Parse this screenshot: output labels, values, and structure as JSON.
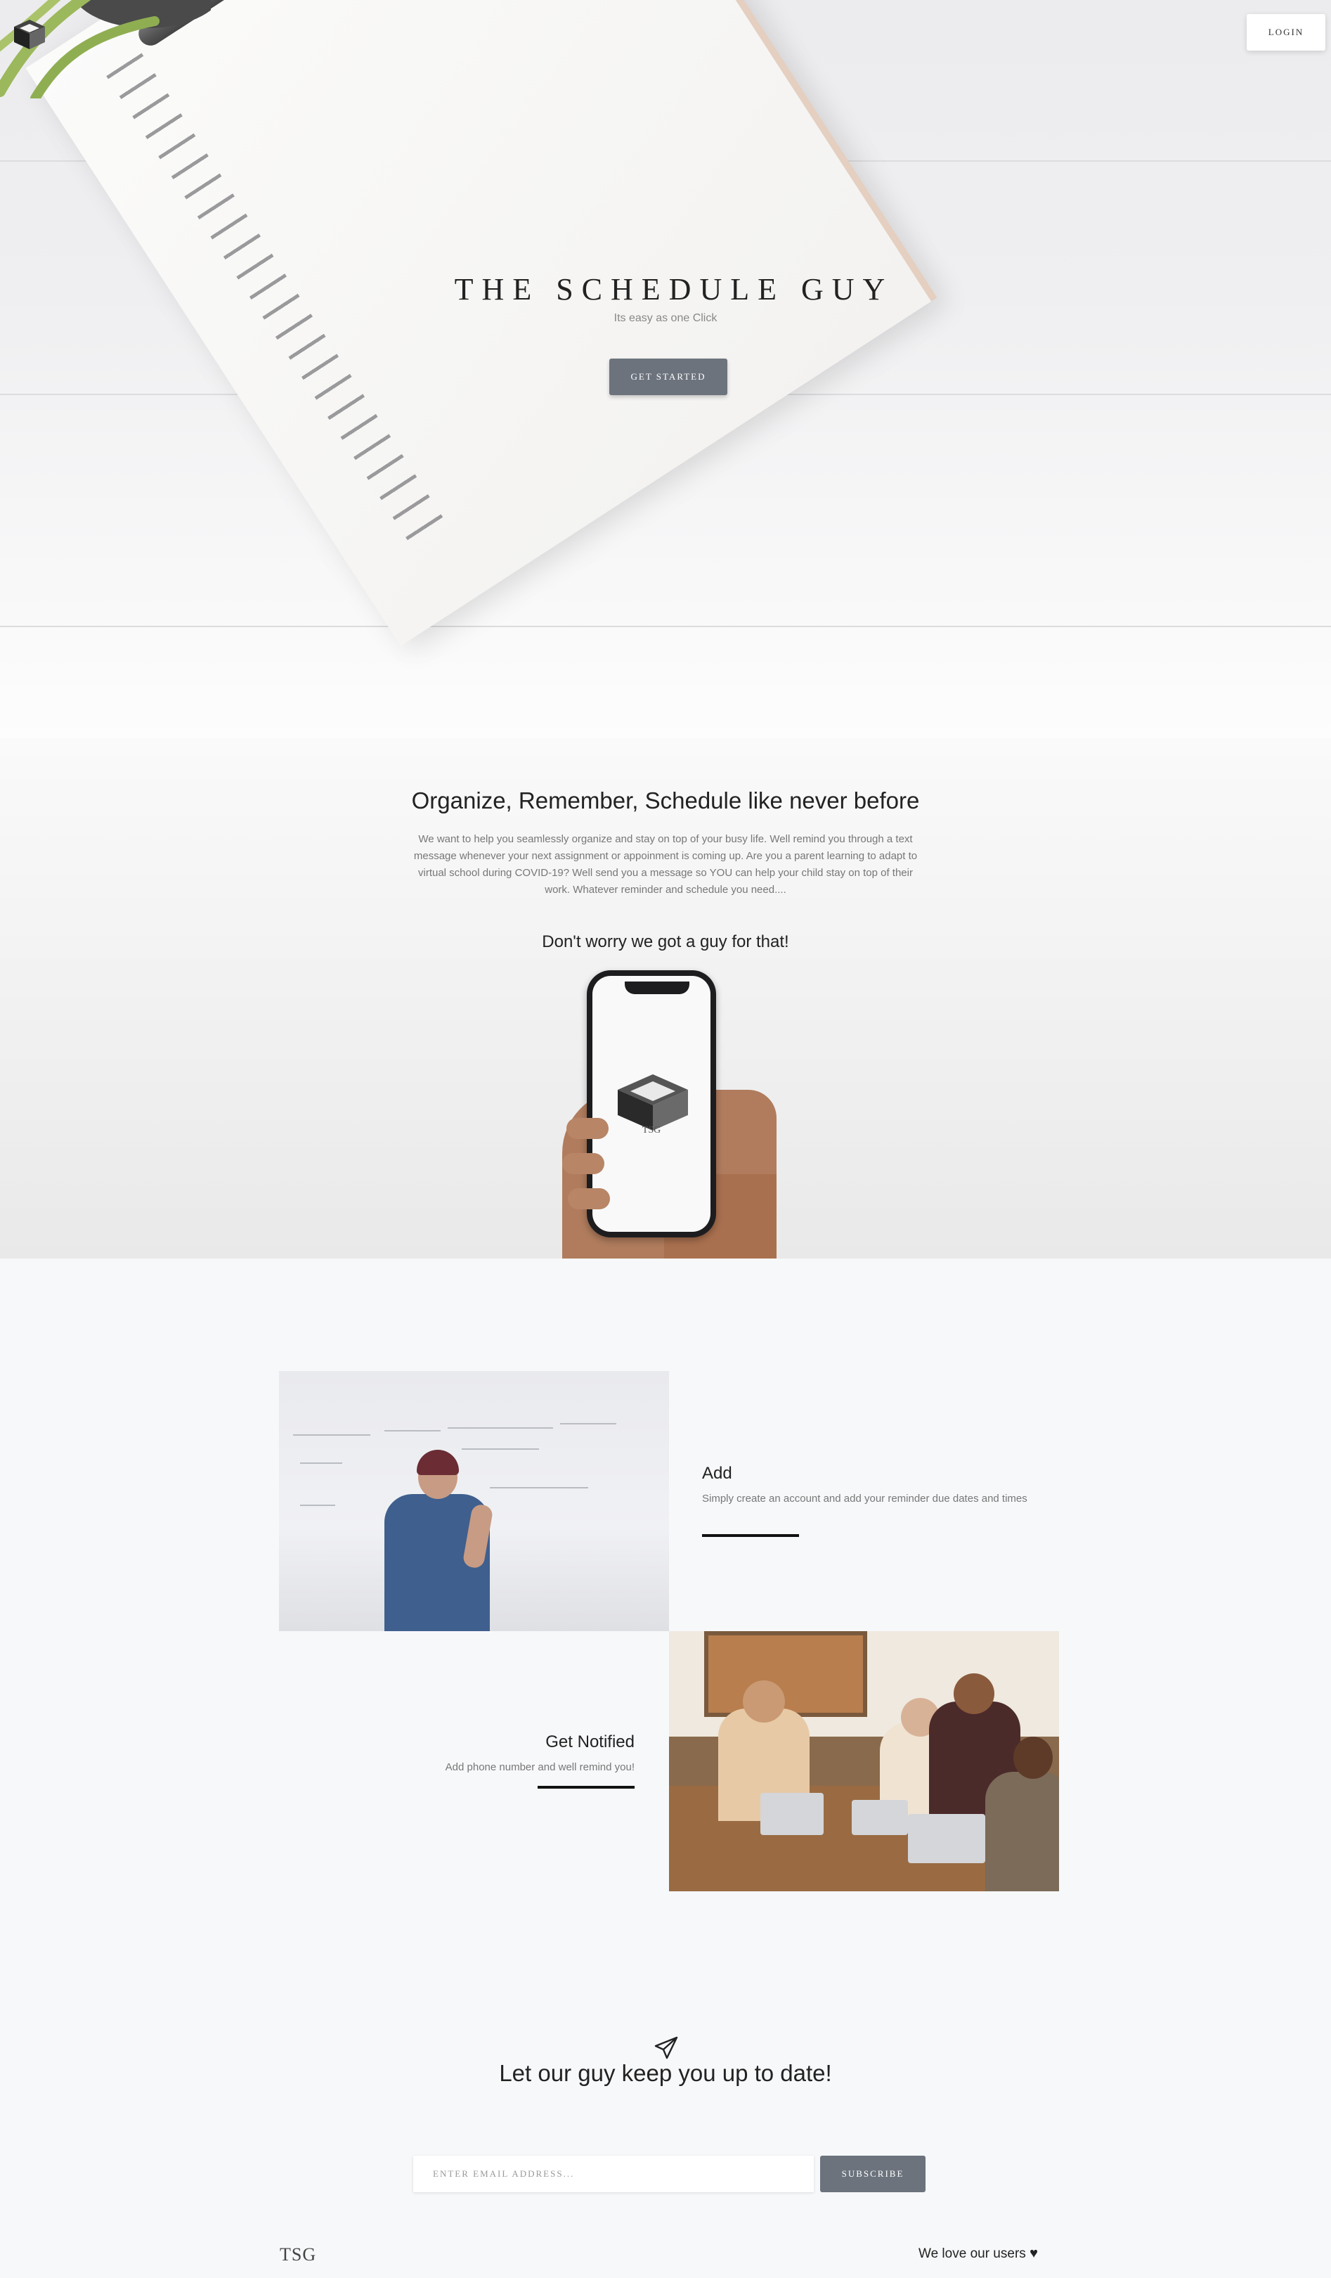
{
  "header": {
    "login_label": "LOGIN"
  },
  "hero": {
    "title": "THE SCHEDULE GUY",
    "subtitle": "Its easy as one Click",
    "cta_label": "GET STARTED"
  },
  "intro": {
    "title": "Organize, Remember, Schedule like never before",
    "body": "We want to help you seamlessly organize and stay on top of your busy life. Well remind you through a text message whenever your next assignment or appoinment is coming up. Are you a parent learning to adapt to virtual school during COVID-19? Well send you a message so YOU can help your child stay on top of their work. Whatever reminder and schedule you need....",
    "tagline": "Don't worry we got a guy for that!",
    "phone_brand": "TSG"
  },
  "features": [
    {
      "title": "Add",
      "text": "Simply create an account and add your reminder due dates and times"
    },
    {
      "title": "Get Notified",
      "text": "Add phone number and well remind you!"
    }
  ],
  "newsletter": {
    "icon": "paper-plane-icon",
    "title": "Let our guy keep you up to date!",
    "email_placeholder": "ENTER EMAIL ADDRESS...",
    "subscribe_label": "SUBSCRIBE"
  },
  "footer": {
    "logo_text": "TSG",
    "love_text": "We love our users",
    "heart_icon": "♥"
  },
  "colors": {
    "accent_button": "#6c737d",
    "text_dark": "#222222",
    "text_muted": "#777777",
    "page_bg": "#f7f8fa"
  }
}
